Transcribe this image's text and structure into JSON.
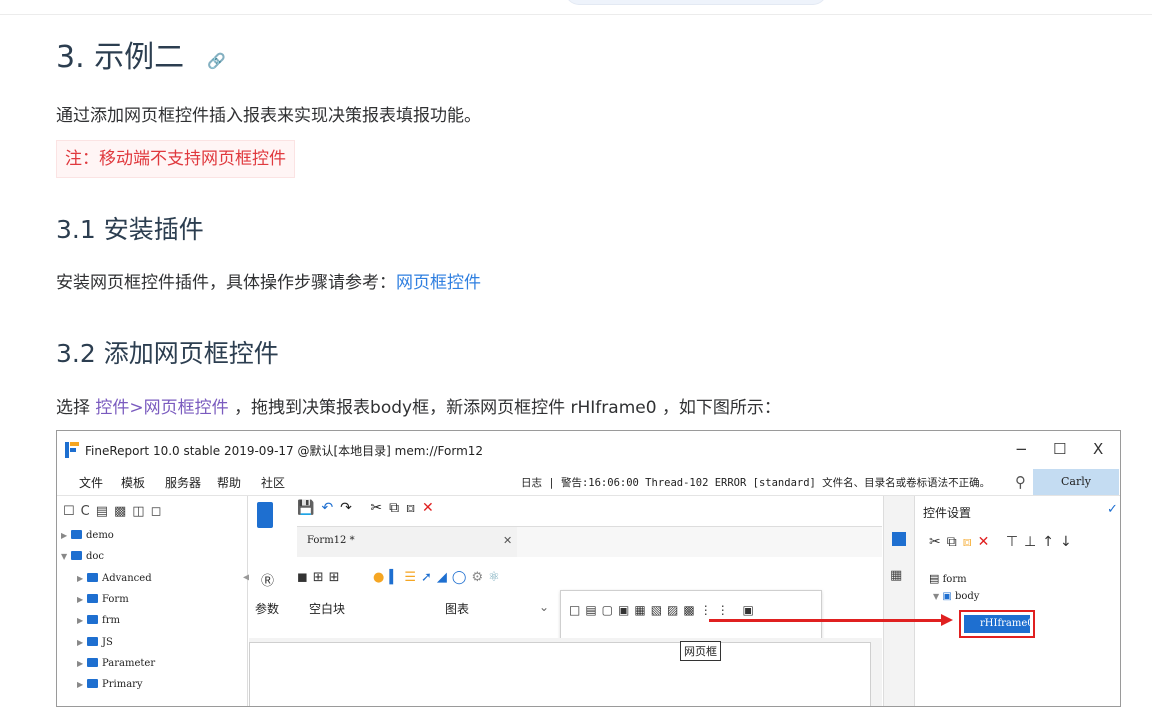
{
  "heading": {
    "title": "3. 示例二",
    "anchor_icon": "link-icon"
  },
  "intro": "通过添加网页框控件插入报表来实现决策报表填报功能。",
  "note": "注：移动端不支持网页框控件",
  "section1": {
    "title": "3.1 安装插件",
    "text": "安装网页框控件插件，具体操作步骤请参考：",
    "link": "网页框控件"
  },
  "section2": {
    "title": "3.2 添加网页框控件",
    "text_pre": "选择",
    "code_path": "控件>网页框控件",
    "text_mid": "，拖拽到决策报表body框，新添网页框控件",
    "widget_name": "rHIframe0",
    "text_post": "，如下图所示："
  },
  "screenshot": {
    "title": "FineReport 10.0 stable 2019-09-17 @默认[本地目录]   mem://Form12",
    "window_controls": [
      "−",
      "☐",
      "X"
    ],
    "menu": [
      "文件",
      "模板",
      "服务器",
      "帮助",
      "社区"
    ],
    "log": "日志 | 警告:16:06:00 Thread-102 ERROR [standard] 文件名、目录名或卷标语法不正确。",
    "user": "Carly",
    "tree": [
      {
        "label": "demo",
        "level": 0,
        "expanded": false
      },
      {
        "label": "doc",
        "level": 0,
        "expanded": true
      },
      {
        "label": "Advanced",
        "level": 1,
        "expanded": false
      },
      {
        "label": "Form",
        "level": 1,
        "expanded": false
      },
      {
        "label": "frm",
        "level": 1,
        "expanded": false
      },
      {
        "label": "JS",
        "level": 1,
        "expanded": false
      },
      {
        "label": "Parameter",
        "level": 1,
        "expanded": false
      },
      {
        "label": "Primary",
        "level": 1,
        "expanded": false
      }
    ],
    "tab_label": "Form12 *",
    "ribbon": {
      "param": "参数",
      "blank": "空白块",
      "chart": "图表"
    },
    "tooltip": "网页框",
    "right_panel": {
      "title": "控件设置",
      "form": "form",
      "body": "body",
      "selected": "rHIframe0"
    },
    "colors": {
      "accent": "#1e6fd0",
      "highlight": "#e02020"
    }
  }
}
